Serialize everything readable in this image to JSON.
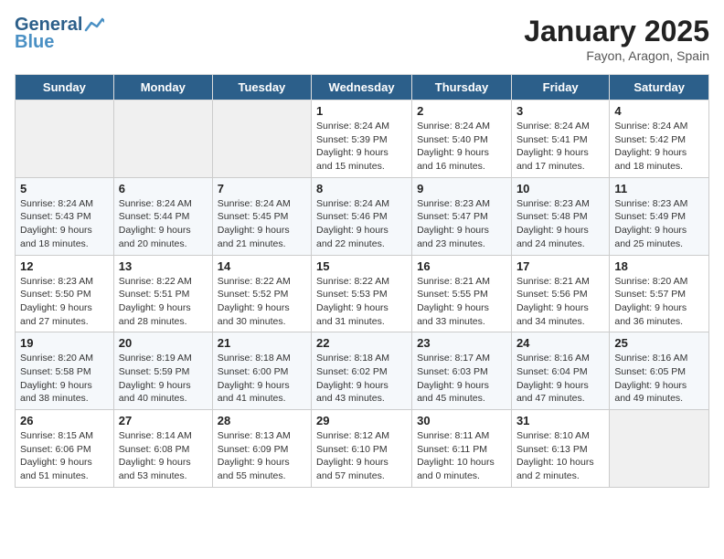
{
  "logo": {
    "general": "General",
    "blue": "Blue"
  },
  "title": "January 2025",
  "subtitle": "Fayon, Aragon, Spain",
  "days_of_week": [
    "Sunday",
    "Monday",
    "Tuesday",
    "Wednesday",
    "Thursday",
    "Friday",
    "Saturday"
  ],
  "weeks": [
    [
      {
        "day": "",
        "info": ""
      },
      {
        "day": "",
        "info": ""
      },
      {
        "day": "",
        "info": ""
      },
      {
        "day": "1",
        "info": "Sunrise: 8:24 AM\nSunset: 5:39 PM\nDaylight: 9 hours and 15 minutes."
      },
      {
        "day": "2",
        "info": "Sunrise: 8:24 AM\nSunset: 5:40 PM\nDaylight: 9 hours and 16 minutes."
      },
      {
        "day": "3",
        "info": "Sunrise: 8:24 AM\nSunset: 5:41 PM\nDaylight: 9 hours and 17 minutes."
      },
      {
        "day": "4",
        "info": "Sunrise: 8:24 AM\nSunset: 5:42 PM\nDaylight: 9 hours and 18 minutes."
      }
    ],
    [
      {
        "day": "5",
        "info": "Sunrise: 8:24 AM\nSunset: 5:43 PM\nDaylight: 9 hours and 18 minutes."
      },
      {
        "day": "6",
        "info": "Sunrise: 8:24 AM\nSunset: 5:44 PM\nDaylight: 9 hours and 20 minutes."
      },
      {
        "day": "7",
        "info": "Sunrise: 8:24 AM\nSunset: 5:45 PM\nDaylight: 9 hours and 21 minutes."
      },
      {
        "day": "8",
        "info": "Sunrise: 8:24 AM\nSunset: 5:46 PM\nDaylight: 9 hours and 22 minutes."
      },
      {
        "day": "9",
        "info": "Sunrise: 8:23 AM\nSunset: 5:47 PM\nDaylight: 9 hours and 23 minutes."
      },
      {
        "day": "10",
        "info": "Sunrise: 8:23 AM\nSunset: 5:48 PM\nDaylight: 9 hours and 24 minutes."
      },
      {
        "day": "11",
        "info": "Sunrise: 8:23 AM\nSunset: 5:49 PM\nDaylight: 9 hours and 25 minutes."
      }
    ],
    [
      {
        "day": "12",
        "info": "Sunrise: 8:23 AM\nSunset: 5:50 PM\nDaylight: 9 hours and 27 minutes."
      },
      {
        "day": "13",
        "info": "Sunrise: 8:22 AM\nSunset: 5:51 PM\nDaylight: 9 hours and 28 minutes."
      },
      {
        "day": "14",
        "info": "Sunrise: 8:22 AM\nSunset: 5:52 PM\nDaylight: 9 hours and 30 minutes."
      },
      {
        "day": "15",
        "info": "Sunrise: 8:22 AM\nSunset: 5:53 PM\nDaylight: 9 hours and 31 minutes."
      },
      {
        "day": "16",
        "info": "Sunrise: 8:21 AM\nSunset: 5:55 PM\nDaylight: 9 hours and 33 minutes."
      },
      {
        "day": "17",
        "info": "Sunrise: 8:21 AM\nSunset: 5:56 PM\nDaylight: 9 hours and 34 minutes."
      },
      {
        "day": "18",
        "info": "Sunrise: 8:20 AM\nSunset: 5:57 PM\nDaylight: 9 hours and 36 minutes."
      }
    ],
    [
      {
        "day": "19",
        "info": "Sunrise: 8:20 AM\nSunset: 5:58 PM\nDaylight: 9 hours and 38 minutes."
      },
      {
        "day": "20",
        "info": "Sunrise: 8:19 AM\nSunset: 5:59 PM\nDaylight: 9 hours and 40 minutes."
      },
      {
        "day": "21",
        "info": "Sunrise: 8:18 AM\nSunset: 6:00 PM\nDaylight: 9 hours and 41 minutes."
      },
      {
        "day": "22",
        "info": "Sunrise: 8:18 AM\nSunset: 6:02 PM\nDaylight: 9 hours and 43 minutes."
      },
      {
        "day": "23",
        "info": "Sunrise: 8:17 AM\nSunset: 6:03 PM\nDaylight: 9 hours and 45 minutes."
      },
      {
        "day": "24",
        "info": "Sunrise: 8:16 AM\nSunset: 6:04 PM\nDaylight: 9 hours and 47 minutes."
      },
      {
        "day": "25",
        "info": "Sunrise: 8:16 AM\nSunset: 6:05 PM\nDaylight: 9 hours and 49 minutes."
      }
    ],
    [
      {
        "day": "26",
        "info": "Sunrise: 8:15 AM\nSunset: 6:06 PM\nDaylight: 9 hours and 51 minutes."
      },
      {
        "day": "27",
        "info": "Sunrise: 8:14 AM\nSunset: 6:08 PM\nDaylight: 9 hours and 53 minutes."
      },
      {
        "day": "28",
        "info": "Sunrise: 8:13 AM\nSunset: 6:09 PM\nDaylight: 9 hours and 55 minutes."
      },
      {
        "day": "29",
        "info": "Sunrise: 8:12 AM\nSunset: 6:10 PM\nDaylight: 9 hours and 57 minutes."
      },
      {
        "day": "30",
        "info": "Sunrise: 8:11 AM\nSunset: 6:11 PM\nDaylight: 10 hours and 0 minutes."
      },
      {
        "day": "31",
        "info": "Sunrise: 8:10 AM\nSunset: 6:13 PM\nDaylight: 10 hours and 2 minutes."
      },
      {
        "day": "",
        "info": ""
      }
    ]
  ]
}
